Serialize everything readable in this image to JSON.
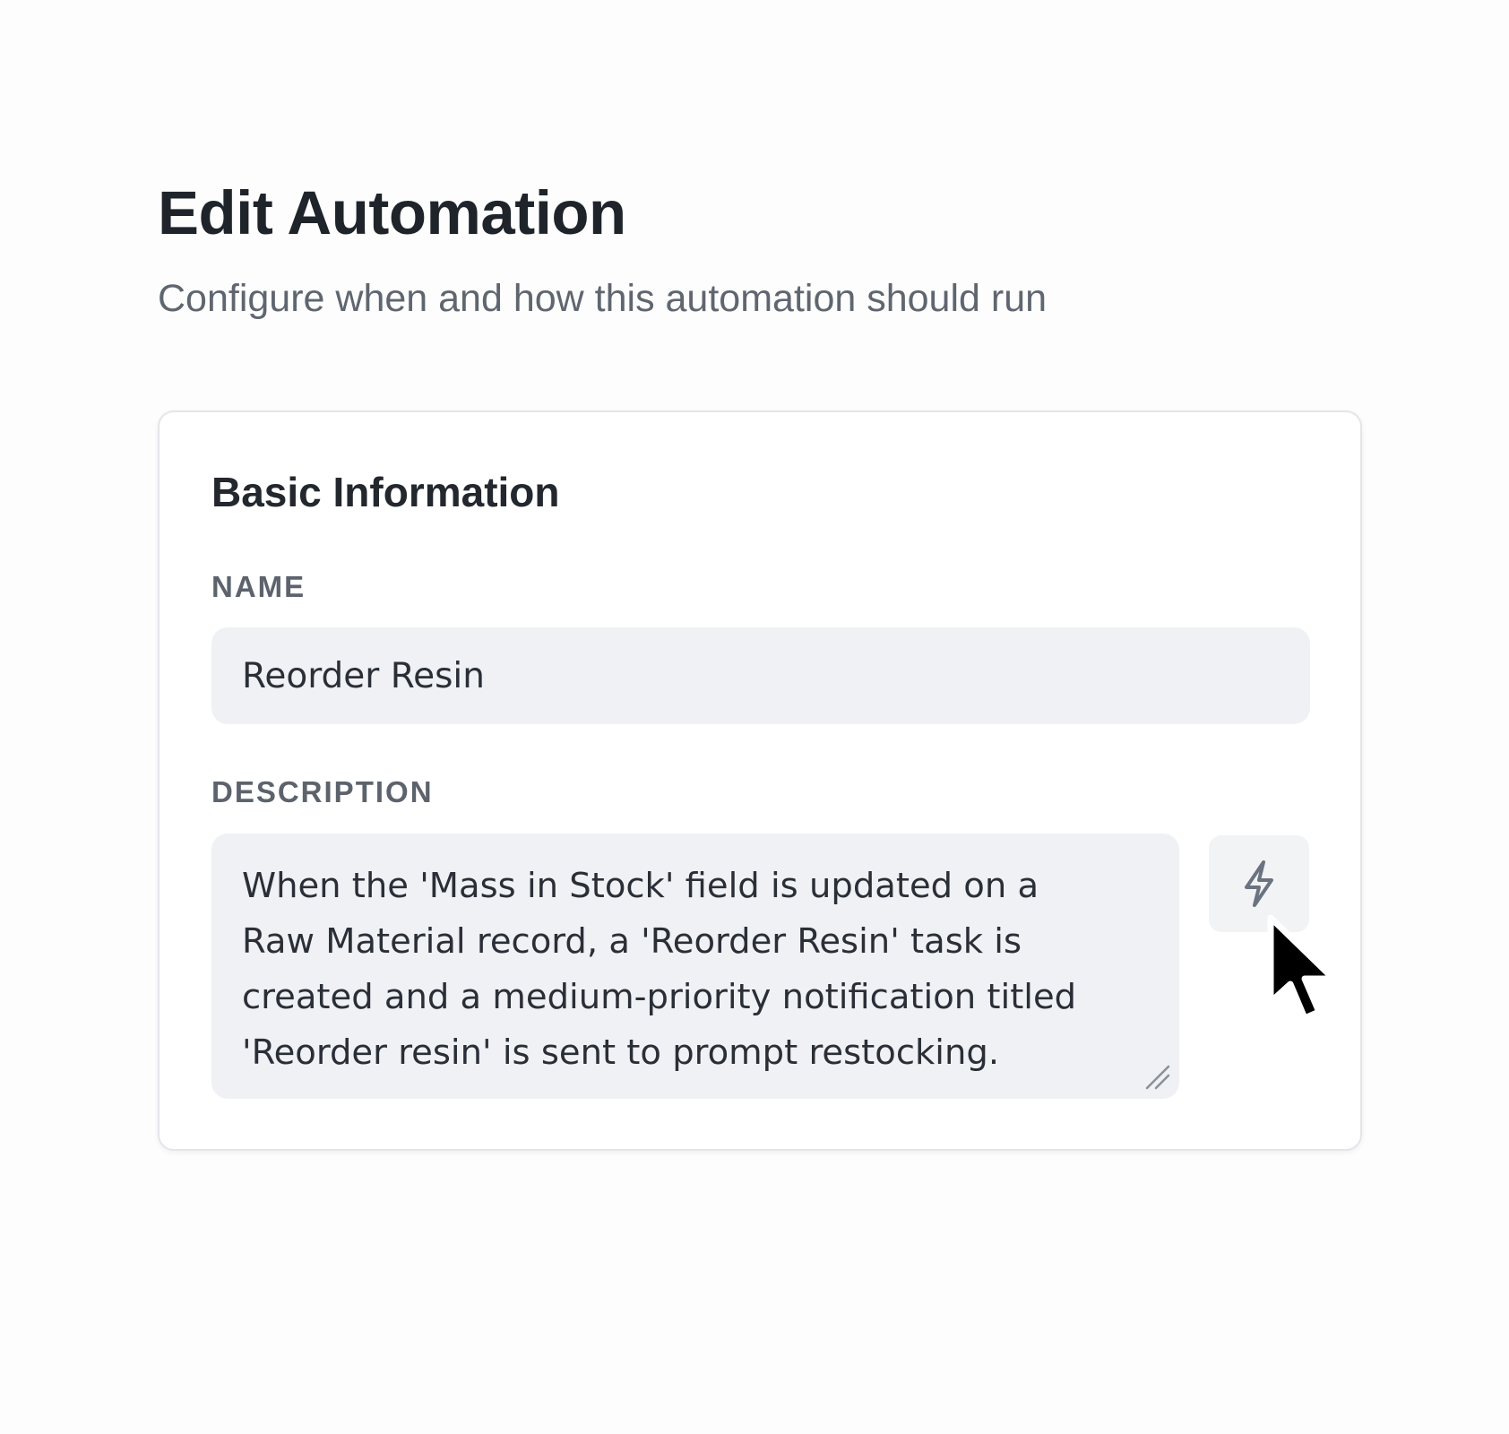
{
  "header": {
    "title": "Edit Automation",
    "subtitle": "Configure when and how this automation should run"
  },
  "basic_info": {
    "section_title": "Basic Information",
    "name_label": "NAME",
    "name_value": "Reorder Resin",
    "description_label": "DESCRIPTION",
    "description_value": "When the 'Mass in Stock' field is updated on a\nRaw Material record, a 'Reorder Resin' task is\ncreated and a medium-priority notification titled\n'Reorder resin' is sent to prompt restocking.",
    "generate_button_icon": "lightning-icon"
  },
  "colors": {
    "accent_gray": "#6b7280",
    "field_background": "#f0f1f4"
  }
}
